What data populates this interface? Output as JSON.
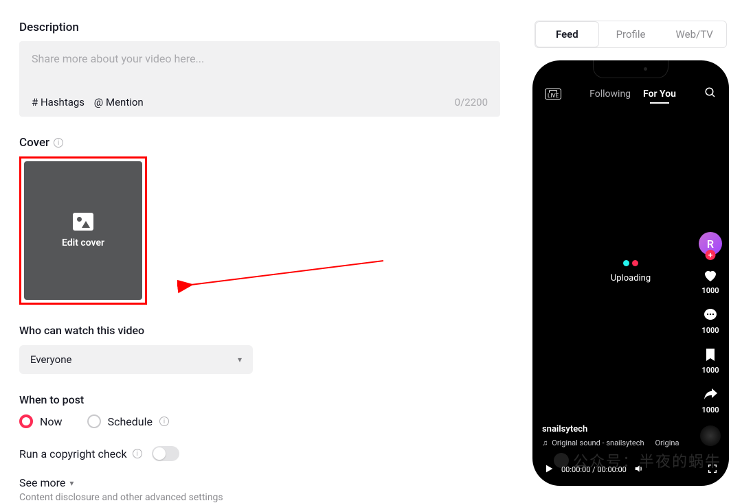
{
  "description": {
    "title": "Description",
    "placeholder": "Share more about your video here...",
    "hashtags_label": "# Hashtags",
    "mention_label": "@ Mention",
    "count": "0/2200"
  },
  "cover": {
    "title": "Cover",
    "button": "Edit cover"
  },
  "privacy": {
    "title": "Who can watch this video",
    "selected": "Everyone"
  },
  "when": {
    "title": "When to post",
    "now": "Now",
    "schedule": "Schedule"
  },
  "copyright": {
    "title": "Run a copyright check"
  },
  "seemore": {
    "title": "See more",
    "sub": "Content disclosure and other advanced settings"
  },
  "preview": {
    "tabs": {
      "feed": "Feed",
      "profile": "Profile",
      "web": "Web/TV"
    },
    "top": {
      "following": "Following",
      "foryou": "For You"
    },
    "uploading": "Uploading",
    "avatar_letter": "R",
    "counts": {
      "like": "1000",
      "comment": "1000",
      "bookmark": "1000",
      "share": "1000"
    },
    "caption_user": "snailsytech",
    "caption_sound_prefix": "Original sound - snailsytech",
    "caption_sound_suffix": "Origina",
    "time": "00:00:00 / 00:00:00"
  },
  "watermark": "公众号：半夜的蜗牛"
}
